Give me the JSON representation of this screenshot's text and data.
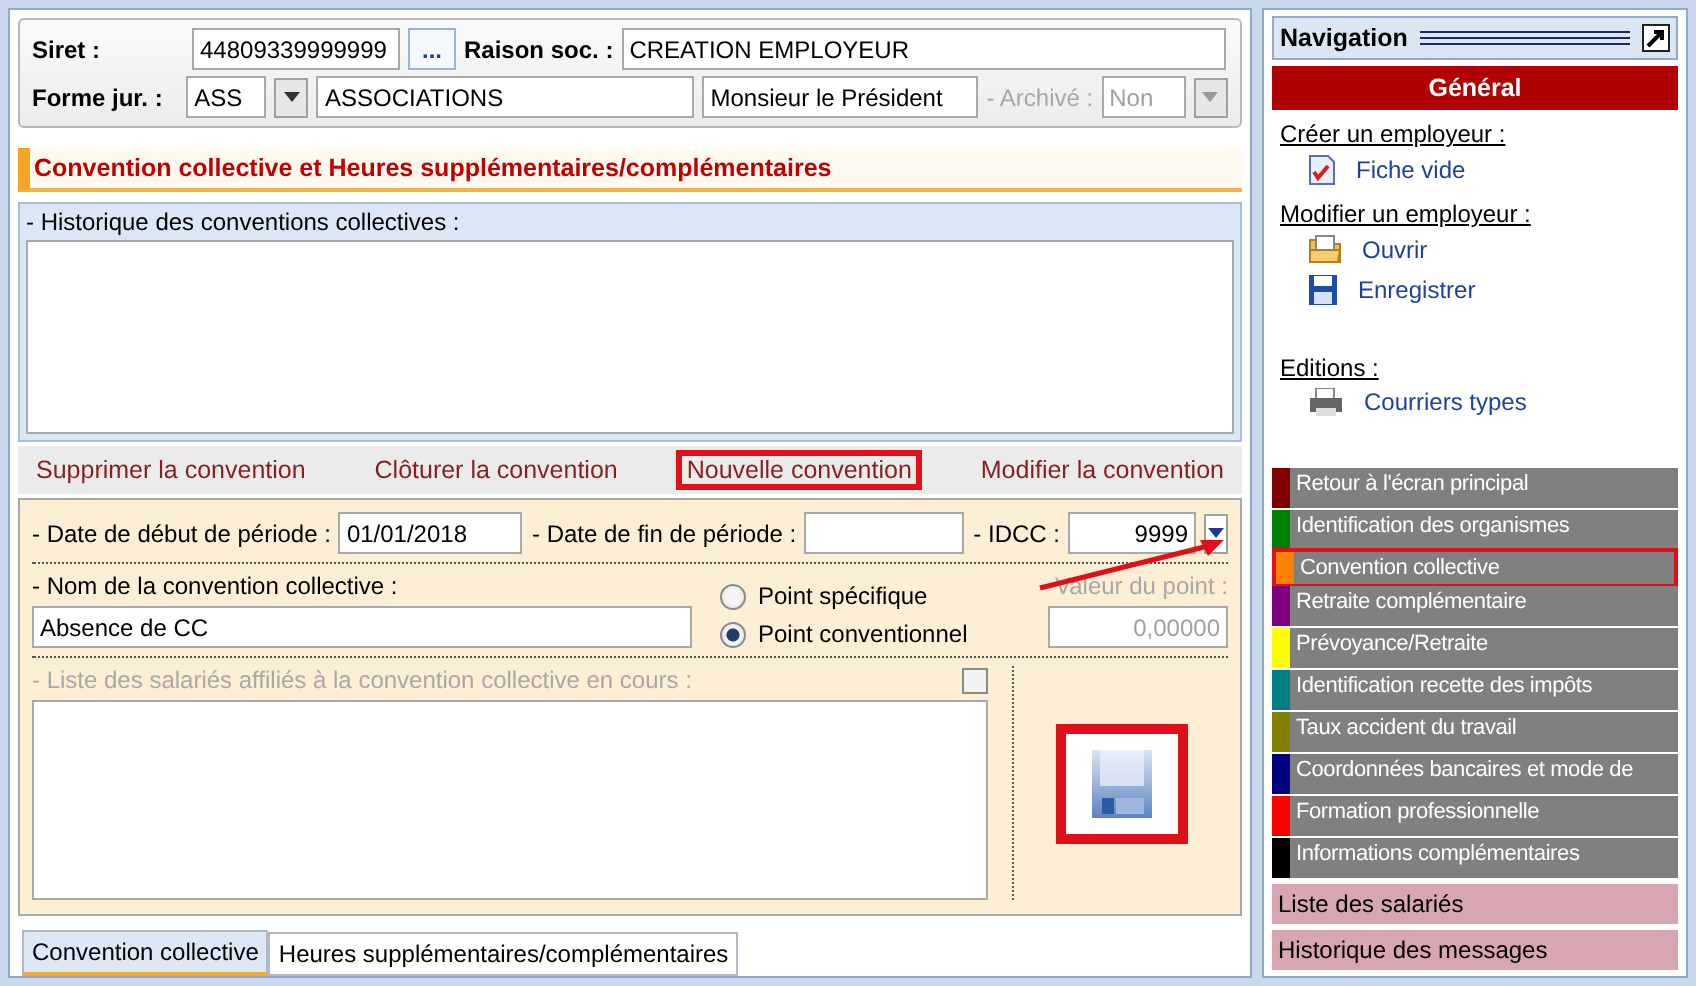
{
  "header": {
    "siret_label": "Siret :",
    "siret": "44809339999999",
    "lookup_button": "...",
    "raison_label": "Raison soc. :",
    "raison": "CREATION EMPLOYEUR",
    "forme_label": "Forme jur. :",
    "forme_code": "ASS",
    "forme_name": "ASSOCIATIONS",
    "representative": "Monsieur le Président",
    "archive_label": "- Archivé :",
    "archive_value": "Non",
    "archive_disabled": true
  },
  "section_title": "Convention collective et Heures supplémentaires/complémentaires",
  "history": {
    "label": "- Historique des conventions collectives :"
  },
  "actions": [
    {
      "label": "Supprimer la convention",
      "highlighted": false
    },
    {
      "label": "Clôturer la convention",
      "highlighted": false
    },
    {
      "label": "Nouvelle convention",
      "highlighted": true
    },
    {
      "label": "Modifier la convention",
      "highlighted": false
    }
  ],
  "form": {
    "start_label": "- Date de début de période :",
    "start_value": "01/01/2018",
    "end_label": "- Date de fin de période :",
    "idcc_label": "- IDCC :",
    "idcc_value": "9999",
    "name_label": "- Nom de la convention collective :",
    "name_value": "Absence de CC",
    "radios": [
      {
        "label": "Point spécifique",
        "selected": false
      },
      {
        "label": "Point conventionnel",
        "selected": true
      }
    ],
    "point_label": "Valeur du point :",
    "point_value": "0,00000",
    "point_disabled": true,
    "employees_label": "- Liste des salariés affiliés à la convention collective en cours :",
    "employees_disabled": true,
    "employees_checked": false,
    "save_highlighted": true
  },
  "tabs": [
    {
      "label": "Convention collective",
      "selected": true
    },
    {
      "label": "Heures supplémentaires/complémentaires",
      "selected": false
    }
  ],
  "navigation": {
    "title": "Navigation",
    "section": "Général",
    "groups": [
      {
        "heading": "Créer un employeur :",
        "links": [
          {
            "label": "Fiche vide",
            "kind": "document"
          }
        ]
      },
      {
        "heading": "Modifier un employeur :",
        "links": [
          {
            "label": "Ouvrir",
            "kind": "open"
          },
          {
            "label": "Enregistrer",
            "kind": "save"
          }
        ]
      },
      {
        "heading": "Editions :",
        "links": [
          {
            "label": "Courriers types",
            "kind": "print"
          }
        ]
      }
    ],
    "modules": [
      {
        "label": "Retour à l'écran principal",
        "color": "#800000",
        "highlighted": false
      },
      {
        "label": "Identification des organismes",
        "color": "#008000",
        "highlighted": false
      },
      {
        "label": "Convention collective",
        "color": "#ff8000",
        "highlighted": true
      },
      {
        "label": "Retraite complémentaire",
        "color": "#800080",
        "highlighted": false
      },
      {
        "label": "Prévoyance/Retraite",
        "color": "#ffff00",
        "highlighted": false
      },
      {
        "label": "Identification recette des impôts",
        "color": "#008080",
        "highlighted": false
      },
      {
        "label": "Taux accident du travail",
        "color": "#808000",
        "highlighted": false
      },
      {
        "label": "Coordonnées bancaires et mode de",
        "color": "#000080",
        "highlighted": false
      },
      {
        "label": "Formation professionnelle",
        "color": "#ff0000",
        "highlighted": false
      },
      {
        "label": "Informations complémentaires",
        "color": "#000000",
        "highlighted": false
      }
    ],
    "extras": [
      {
        "label": "Liste des salariés"
      },
      {
        "label": "Historique des messages"
      }
    ]
  }
}
